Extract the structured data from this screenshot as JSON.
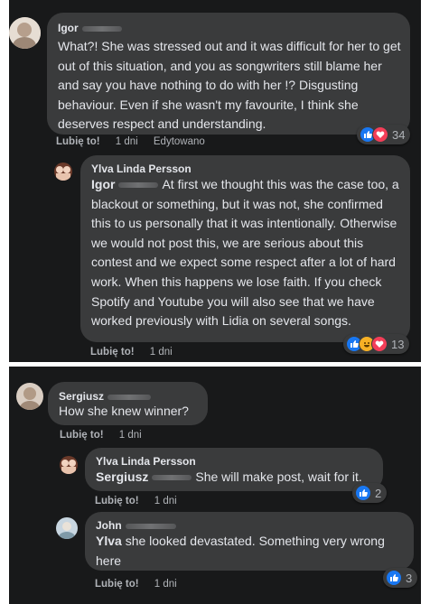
{
  "comments": {
    "igor": {
      "author": "Igor",
      "text": "What?! She was stressed out and it was difficult for her to get out of this situation, and you as songwriters still blame her and say you have nothing to do with her !? Disgusting behaviour. Even if she wasn't my favourite, I think she deserves respect and understanding.",
      "like_label": "Lubię to!",
      "time": "1 dni",
      "edited": "Edytowano",
      "reaction_count": "34"
    },
    "ylva_reply_1": {
      "author": "Ylva Linda Persson",
      "mention": "Igor",
      "text": "At first we thought this was the case too, a blackout or something, but it was not, she confirmed this to us personally that it was intentionally. Otherwise we would not post this, we are serious about this contest and we expect some respect after a lot of hard work. When this happens we lose faith. If you check Spotify and Youtube you will also see that we have worked previously with Lidia on several songs.",
      "like_label": "Lubię to!",
      "time": "1 dni",
      "reaction_count": "13"
    },
    "sergiusz": {
      "author": "Sergiusz",
      "text": "How she knew winner?",
      "like_label": "Lubię to!",
      "time": "1 dni"
    },
    "ylva_reply_2": {
      "author": "Ylva Linda Persson",
      "mention": "Sergiusz",
      "text": "She will make post, wait for it.",
      "like_label": "Lubię to!",
      "time": "1 dni",
      "reaction_count": "2"
    },
    "john": {
      "author": "John",
      "mention": "Ylva",
      "text": "she looked devastated. Something very wrong here",
      "like_label": "Lubię to!",
      "time": "1 dni",
      "reaction_count": "3"
    }
  },
  "colors": {
    "panel_bg": "#18191a",
    "bubble_bg": "#3a3b3c",
    "text": "#e4e6eb",
    "muted": "#b0b3b8",
    "like_blue": "#1877f2",
    "heart_red": "#f33e58",
    "haha_yellow": "#f7b125"
  }
}
